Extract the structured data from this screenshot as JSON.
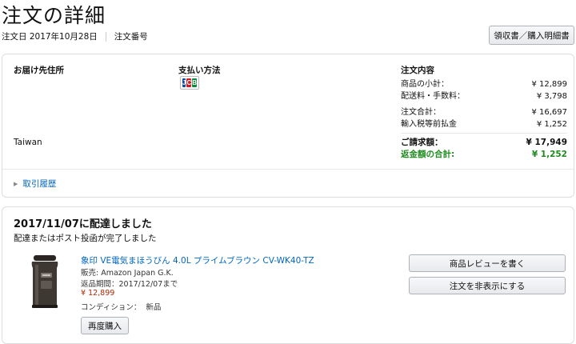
{
  "page": {
    "title": "注文の詳細",
    "order_date_label": "注文日 2017年10月28日",
    "order_number_label": "注文番号",
    "receipt_button": "領収書／購入明細書"
  },
  "details": {
    "shipping_address_heading": "お届け先住所",
    "shipping_country": "Taiwan",
    "payment_heading": "支払い方法",
    "payment_icon": "jcb-card-icon",
    "summary_heading": "注文内容",
    "summary_rows": [
      {
        "label": "商品の小計：",
        "value": "¥ 12,899"
      },
      {
        "label": "配送料・手数料：",
        "value": "¥ 3,798"
      },
      {
        "label": "注文合計：",
        "value": "¥ 16,697"
      },
      {
        "label": "輸入税等前払金",
        "value": "¥ 1,252"
      },
      {
        "label": "ご請求額：",
        "value": "¥ 17,949"
      },
      {
        "label": "返金額の合計:",
        "value": "¥ 1,252"
      }
    ],
    "refund_color": "#1e8a1e",
    "history_link": "取引履歴"
  },
  "shipment": {
    "status_title": "2017/11/07に配達しました",
    "status_subtitle": "配達またはポスト投函が完了しました",
    "product_title": "象印 VE電気まほうびん 4.0L プライムブラウン CV-WK40-TZ",
    "seller": "販売: Amazon Japan G.K.",
    "return_period": "返品期間：2017/12/07まで",
    "price": "¥ 12,899",
    "condition_label": "コンディション：",
    "condition_value": "新品",
    "rebuy_button": "再度購入",
    "review_button": "商品レビューを書く",
    "hide_order_button": "注文を非表示にする",
    "link_color": "#0066c0",
    "price_color": "#b12704"
  }
}
